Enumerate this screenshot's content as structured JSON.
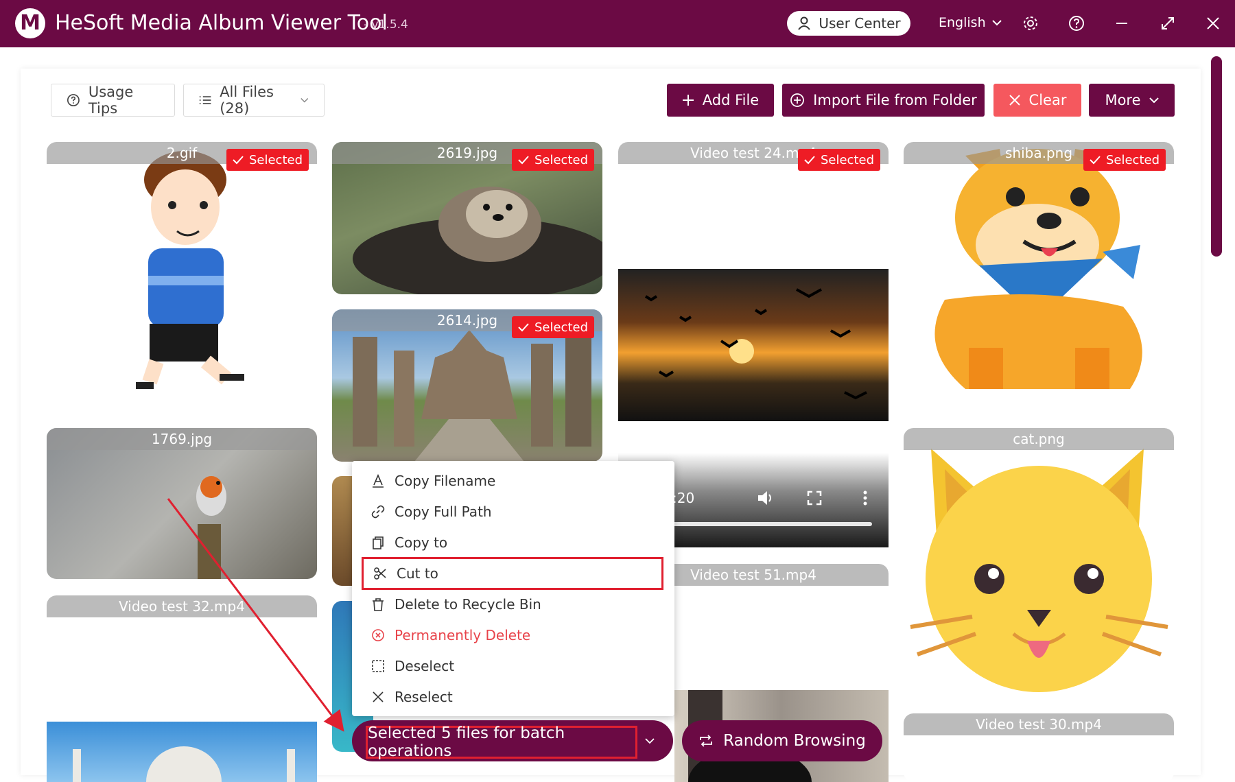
{
  "app": {
    "title": "HeSoft Media Album Viewer Tool",
    "version": "- v1.5.4",
    "logo_letter": "M",
    "brand_color": "#6b0a44"
  },
  "titlebar": {
    "user_center": "User Center",
    "language": "English"
  },
  "toolbar": {
    "usage_tips": "Usage Tips",
    "all_files": "All Files (28)",
    "add_file": "Add File",
    "import_folder": "Import File from Folder",
    "clear": "Clear",
    "more": "More"
  },
  "cards": {
    "c1": {
      "name": "2.gif",
      "badge": "Selected"
    },
    "c2": {
      "name": "2619.jpg",
      "badge": "Selected"
    },
    "c3": {
      "name": "Video test 24.mp4",
      "badge": "Selected"
    },
    "c4": {
      "name": "shiba.png",
      "badge": "Selected"
    },
    "c5": {
      "name": "2614.jpg",
      "badge": "Selected"
    },
    "c6": {
      "name": "1769.jpg"
    },
    "c7": {
      "name": "Video test 32.mp4"
    },
    "c8": {
      "name": "Video test 51.mp4",
      "time": ":20"
    },
    "c9": {
      "name": "cat.png"
    },
    "c10": {
      "name": "Video test 30.mp4"
    }
  },
  "context_menu": {
    "items": [
      {
        "label": "Copy Filename",
        "icon": "text-a-icon"
      },
      {
        "label": "Copy Full Path",
        "icon": "link-icon"
      },
      {
        "label": "Copy to",
        "icon": "copy-icon"
      },
      {
        "label": "Cut to",
        "icon": "scissors-icon"
      },
      {
        "label": "Delete to Recycle Bin",
        "icon": "trash-icon"
      },
      {
        "label": "Permanently Delete",
        "icon": "circle-x-icon"
      },
      {
        "label": "Deselect",
        "icon": "dashed-square-icon"
      },
      {
        "label": "Reselect",
        "icon": "x-icon"
      }
    ]
  },
  "bottom": {
    "batch": "Selected 5 files for batch operations",
    "random": "Random Browsing"
  }
}
